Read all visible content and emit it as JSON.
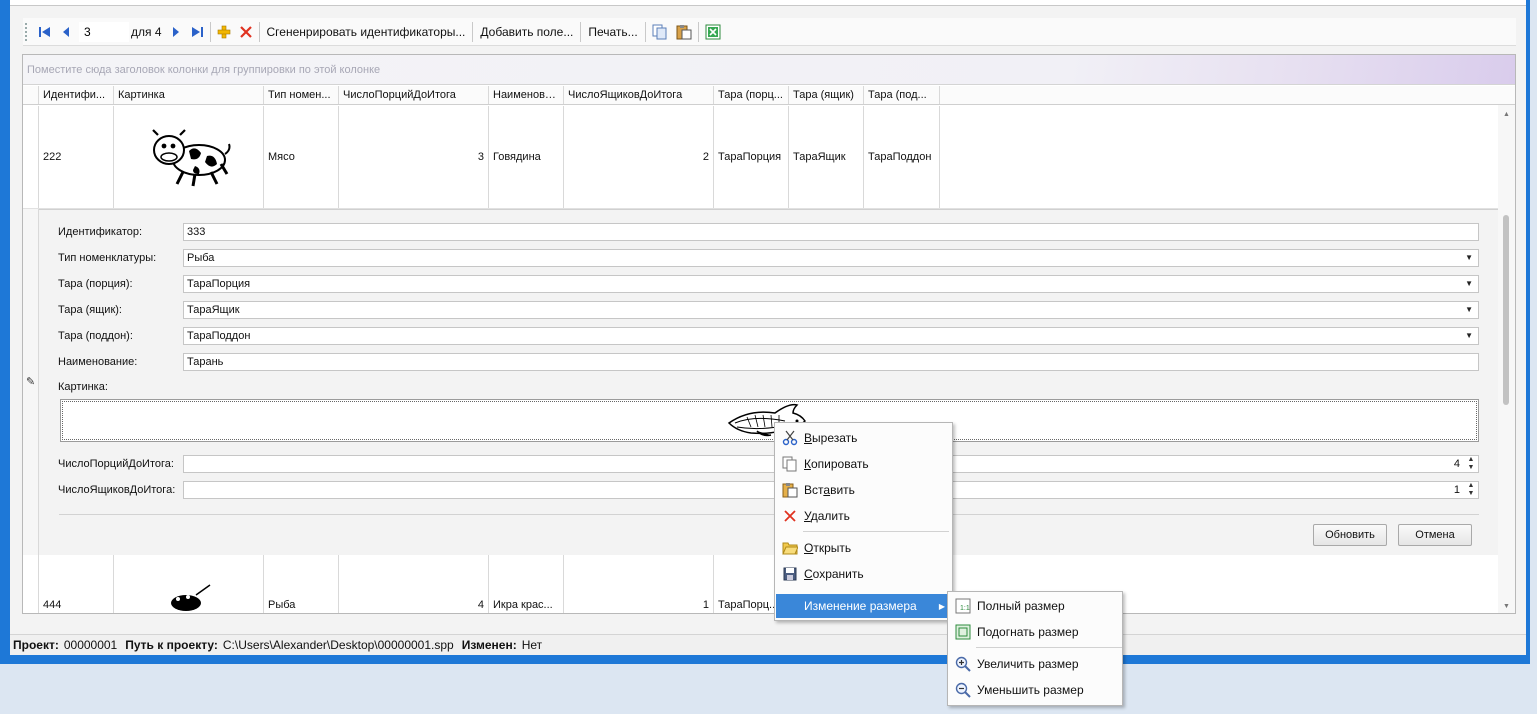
{
  "toolbar": {
    "page_value": "3",
    "page_of": "для 4",
    "generate_ids": "Сгененрировать идентификаторы...",
    "add_field": "Добавить поле...",
    "print": "Печать..."
  },
  "grid": {
    "group_panel_hint": "Поместите сюда заголовок колонки для группировки по этой колонке",
    "columns": [
      "Идентифи...",
      "Картинка",
      "Тип номен...",
      "ЧислоПорцийДоИтога",
      "Наименова...",
      "ЧислоЯщиковДоИтога",
      "Тара (порц...",
      "Тара (ящик)",
      "Тара (под..."
    ],
    "rows": [
      {
        "id": "222",
        "type": "Мясо",
        "portions": "3",
        "name": "Говядина",
        "boxes": "2",
        "tara_portion": "ТараПорция",
        "tara_box": "ТараЯщик",
        "tara_pallet": "ТараПоддон"
      },
      {
        "id": "444",
        "type": "Рыба",
        "portions": "4",
        "name": "Икра крас...",
        "boxes": "1",
        "tara_portion": "ТараПорц..."
      }
    ]
  },
  "form": {
    "id_label": "Идентификатор:",
    "id_value": "333",
    "type_label": "Тип номенклатуры:",
    "type_value": "Рыба",
    "tara_portion_label": "Тара (порция):",
    "tara_portion_value": "ТараПорция",
    "tara_box_label": "Тара (ящик):",
    "tara_box_value": "ТараЯщик",
    "tara_pallet_label": "Тара (поддон):",
    "tara_pallet_value": "ТараПоддон",
    "name_label": "Наименование:",
    "name_value": "Тарань",
    "picture_label": "Картинка:",
    "portions_label": "ЧислоПорцийДоИтога:",
    "portions_value": "4",
    "boxes_label": "ЧислоЯщиковДоИтога:",
    "boxes_value": "1",
    "update_button": "Обновить",
    "cancel_button": "Отмена"
  },
  "status": {
    "project_label": "Проект:",
    "project_value": "00000001",
    "path_label": "Путь к проекту:",
    "path_value": "C:\\Users\\Alexander\\Desktop\\00000001.spp",
    "changed_label": "Изменен:",
    "changed_value": "Нет"
  },
  "context_menu": {
    "cut": {
      "underline": "В",
      "rest": "ырезать"
    },
    "copy": {
      "underline": "К",
      "rest": "опировать"
    },
    "paste_pre": "Вст",
    "paste_u": "а",
    "paste_post": "вить",
    "delete": {
      "underline": "У",
      "rest": "далить"
    },
    "open": {
      "underline": "О",
      "rest": "ткрыть"
    },
    "save": {
      "underline": "С",
      "rest": "охранить"
    },
    "resize": "Изменение размера"
  },
  "submenu": {
    "full_size": "Полный размер",
    "fit_size": "Подогнать размер",
    "zoom_in": "Увеличить размер",
    "zoom_out": "Уменьшить размер"
  }
}
